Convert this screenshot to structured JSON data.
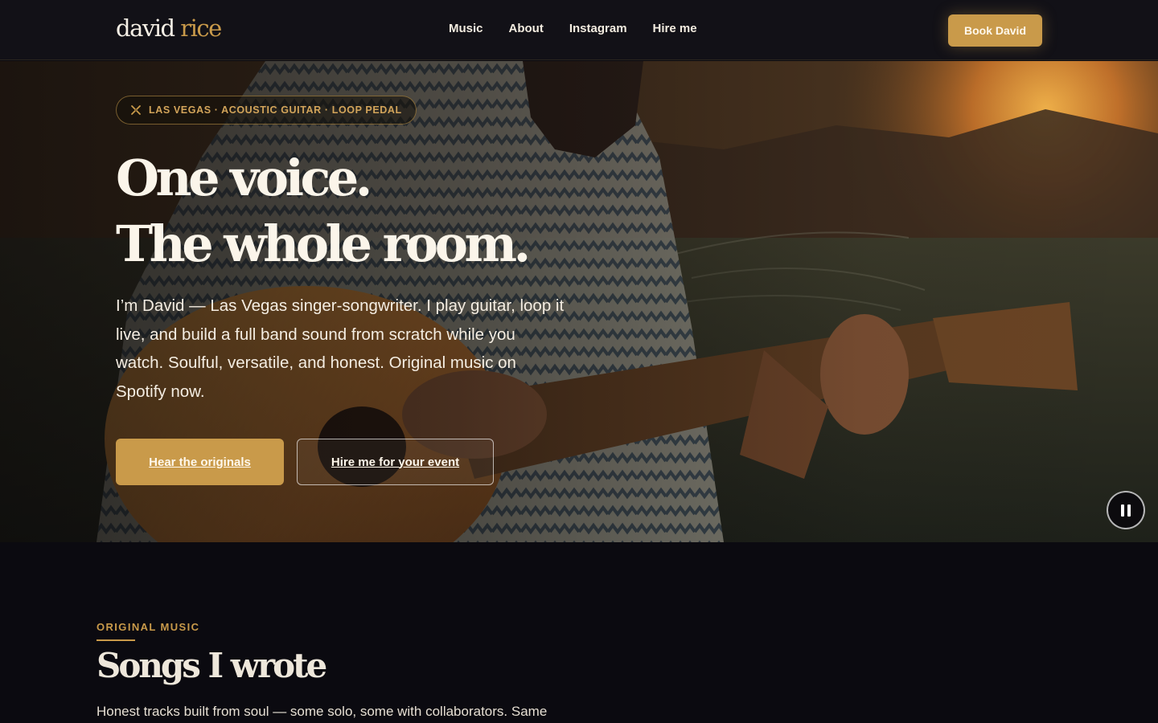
{
  "header": {
    "logo_first": "david",
    "logo_second": "rice",
    "nav": [
      {
        "label": "Music"
      },
      {
        "label": "About"
      },
      {
        "label": "Instagram"
      },
      {
        "label": "Hire me"
      }
    ],
    "cta_label": "Book David"
  },
  "hero": {
    "badge": "LAS VEGAS · ACOUSTIC GUITAR · LOOP PEDAL",
    "badge_icon": "sparkle-icon",
    "headline_line1": "One voice.",
    "headline_line2": "The whole room.",
    "intro": "I’m David — Las Vegas singer-songwriter. I play guitar, loop it live, and build a full band sound from scratch while you watch. Soulful, versatile, and honest. Original music on Spotify now.",
    "primary_cta": "Hear the originals",
    "secondary_cta": "Hire me for your event",
    "pause_icon": "pause-icon"
  },
  "music": {
    "eyebrow": "ORIGINAL MUSIC",
    "title": "Songs I wrote",
    "description": "Honest tracks built from soul — some solo, some with collaborators. Same"
  },
  "colors": {
    "accent": "#c99a4a",
    "background": "#0b0a10",
    "header": "#121117"
  }
}
